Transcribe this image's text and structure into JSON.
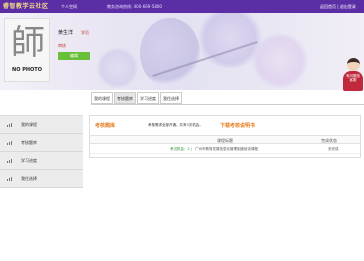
{
  "topbar": {
    "logo_text": "睿智教学云社区",
    "personal_center": "个人空间",
    "hotline": "教务咨询热线: 400-669-5800",
    "logout": "返回首页 | 退出登录"
  },
  "profile": {
    "photo_glyph": "師",
    "photo_label": "NO PHOTO",
    "username": "黄生洋",
    "role": "学员",
    "status": "审核",
    "edit_button": "编辑"
  },
  "mascot": {
    "text": "有问题找客服"
  },
  "tabs": [
    {
      "label": "我的课程",
      "active": false
    },
    {
      "label": "考核题库",
      "active": true
    },
    {
      "label": "学习进度",
      "active": false
    },
    {
      "label": "我住选择",
      "active": false
    }
  ],
  "sidebar": {
    "items": [
      {
        "label": "我的课程"
      },
      {
        "label": "考核题库"
      },
      {
        "label": "学习进度"
      },
      {
        "label": "我住选择"
      }
    ]
  },
  "panel": {
    "title": "考核题库",
    "note": "考核需求全部开通。共有3次机会。",
    "link": "下载考核说明书",
    "columns": {
      "title": "课程标题",
      "status": "完成状态"
    },
    "rows": [
      {
        "action": "考试机会：2 |",
        "title": "广州市教育发展信息化管理制度培训课程",
        "status": "未完成"
      }
    ]
  },
  "colors": {
    "topbar": "#5b2ea6",
    "accent": "#e67e22",
    "edit_button": "#6abf3a"
  }
}
